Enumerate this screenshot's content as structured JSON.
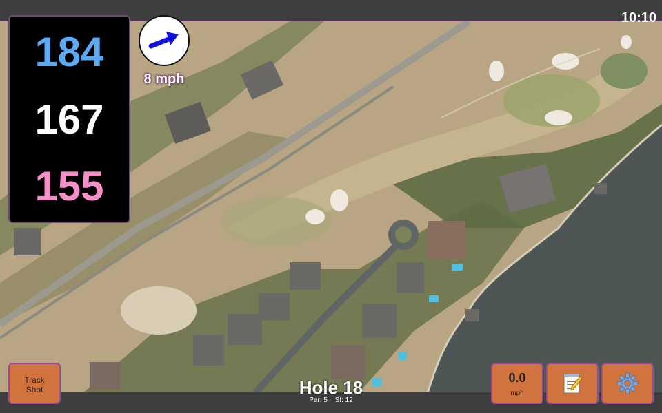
{
  "status": {
    "time": "10:10"
  },
  "distances": {
    "back": "184",
    "middle": "167",
    "front": "155"
  },
  "wind": {
    "speed": "8 mph",
    "icon": "wind-arrow-icon"
  },
  "hole": {
    "title": "Hole 18",
    "par": "Par: 5",
    "si": "SI: 12"
  },
  "buttons": {
    "track_line1": "Track",
    "track_line2": "Shot",
    "speed_value": "0.0",
    "speed_unit": "mph",
    "notes_icon": "notepad-icon",
    "settings_icon": "gear-icon"
  },
  "colors": {
    "back_distance": "#5aaaf5",
    "middle_distance": "#ffffff",
    "front_distance": "#f58fca",
    "button": "#d2723c",
    "button_border": "#9b4a90",
    "water": "#4d5655",
    "bar": "#3e3e3e"
  }
}
